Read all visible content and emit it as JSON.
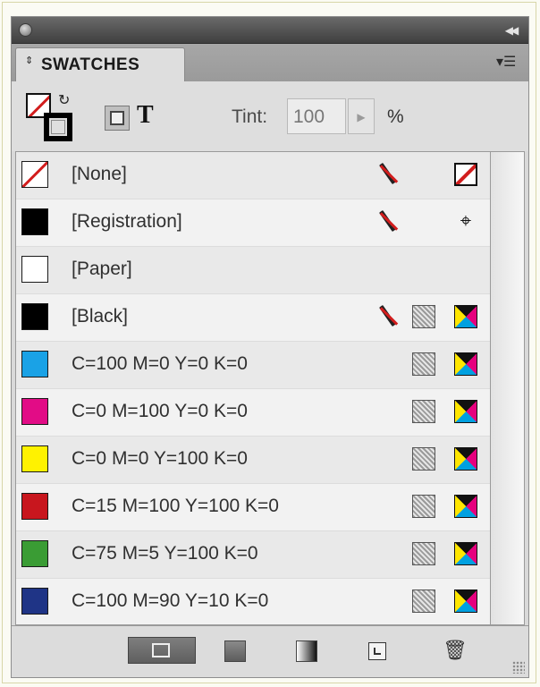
{
  "panel": {
    "tab_label": "SWATCHES",
    "tab_arrows": "⇕"
  },
  "toolbar": {
    "tint_label": "Tint:",
    "tint_value": "100",
    "tint_unit": "%",
    "text_toggle": "T"
  },
  "swatches": [
    {
      "name": "[None]",
      "color": "none",
      "noedit": true,
      "process": false,
      "mode": "none"
    },
    {
      "name": "[Registration]",
      "color": "#000000",
      "noedit": true,
      "process": false,
      "mode": "registration"
    },
    {
      "name": "[Paper]",
      "color": "#ffffff",
      "noedit": false,
      "process": false,
      "mode": ""
    },
    {
      "name": "[Black]",
      "color": "#000000",
      "noedit": true,
      "process": true,
      "mode": "cmyk"
    },
    {
      "name": "C=100 M=0 Y=0 K=0",
      "color": "#1aa2e6",
      "noedit": false,
      "process": true,
      "mode": "cmyk"
    },
    {
      "name": "C=0 M=100 Y=0 K=0",
      "color": "#e20c86",
      "noedit": false,
      "process": true,
      "mode": "cmyk"
    },
    {
      "name": "C=0 M=0 Y=100 K=0",
      "color": "#fff200",
      "noedit": false,
      "process": true,
      "mode": "cmyk"
    },
    {
      "name": "C=15 M=100 Y=100 K=0",
      "color": "#c8161e",
      "noedit": false,
      "process": true,
      "mode": "cmyk"
    },
    {
      "name": "C=75 M=5 Y=100 K=0",
      "color": "#3a9c34",
      "noedit": false,
      "process": true,
      "mode": "cmyk"
    },
    {
      "name": "C=100 M=90 Y=10 K=0",
      "color": "#1f3486",
      "noedit": false,
      "process": true,
      "mode": "cmyk"
    }
  ]
}
